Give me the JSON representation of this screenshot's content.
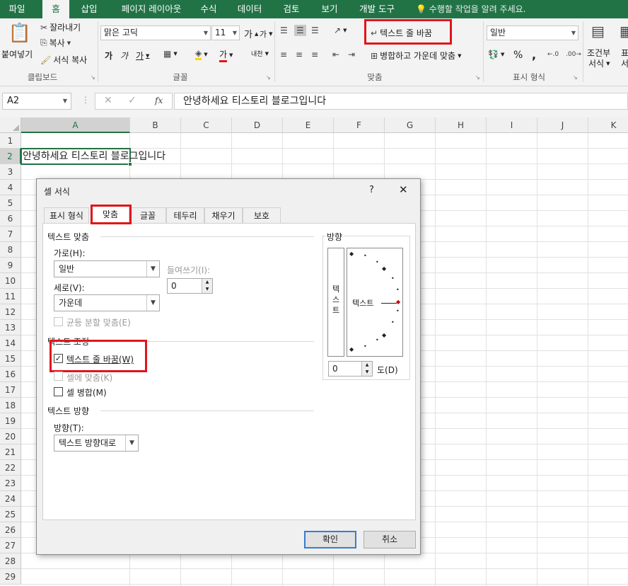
{
  "ribbon_tabs": [
    "파일",
    "홈",
    "삽입",
    "페이지 레이아웃",
    "수식",
    "데이터",
    "검토",
    "보기",
    "개발 도구"
  ],
  "active_tab": "홈",
  "tell_me": "수행할 작업을 알려 주세요.",
  "clipboard": {
    "paste": "붙여넣기",
    "cut": "잘라내기",
    "copy": "복사",
    "format_painter": "서식 복사",
    "group": "클립보드"
  },
  "font": {
    "name": "맑은 고딕",
    "size": "11",
    "grow": "가",
    "shrink": "가",
    "bold": "가",
    "italic": "가",
    "underline": "가",
    "font_color": "가",
    "phonetic": "내천",
    "group": "글꼴"
  },
  "alignment": {
    "wrap_text": "텍스트 줄 바꿈",
    "merge_center": "병합하고 가운데 맞춤",
    "group": "맞춤"
  },
  "number": {
    "format": "일반",
    "percent": "%",
    "comma": ",",
    "group": "표시 형식"
  },
  "styles": {
    "conditional": "조건부",
    "conditional2": "서식",
    "table_fmt": "표",
    "table_fmt2": "서식"
  },
  "formula_bar": {
    "name_box": "A2",
    "fx": "fx",
    "content": "안녕하세요 티스토리 블로그입니다"
  },
  "columns": [
    "A",
    "B",
    "C",
    "D",
    "E",
    "F",
    "G",
    "H",
    "I",
    "J",
    "K"
  ],
  "rows": [
    "1",
    "2",
    "3",
    "4",
    "5",
    "6",
    "7",
    "8",
    "9",
    "10",
    "11",
    "12",
    "13",
    "14",
    "15",
    "16",
    "17",
    "18",
    "19",
    "20",
    "21",
    "22",
    "23",
    "24",
    "25",
    "26",
    "27",
    "28",
    "29"
  ],
  "cell_a2": "안녕하세요 티스토리 블로그입니다",
  "dialog": {
    "title": "셀 서식",
    "help": "?",
    "close": "✕",
    "tabs": [
      "표시 형식",
      "맞춤",
      "글꼴",
      "테두리",
      "채우기",
      "보호"
    ],
    "selected_tab": "맞춤",
    "text_align_section": "텍스트 맞춤",
    "horizontal_label": "가로(H):",
    "horizontal_value": "일반",
    "indent_label": "들여쓰기(I):",
    "indent_value": "0",
    "vertical_label": "세로(V):",
    "vertical_value": "가운데",
    "distributed_label": "균등 분할 맞춤(E)",
    "text_control_section": "텍스트 조정",
    "wrap_label": "텍스트 줄 바꿈(W)",
    "wrap_checked": true,
    "shrink_label": "셀에 맞춤(K)",
    "merge_label": "셀 병합(M)",
    "direction_section": "텍스트 방향",
    "direction_label": "방향(T):",
    "direction_value": "텍스트 방향대로",
    "orientation_section": "방향",
    "vertical_text": "텍\n스\n트",
    "orient_text": "텍스트",
    "degrees_value": "0",
    "degrees_label": "도(D)",
    "ok": "확인",
    "cancel": "취소"
  },
  "colors": {
    "excel_green": "#217346",
    "highlight_red": "#e0151b",
    "selection_green": "#217346"
  }
}
